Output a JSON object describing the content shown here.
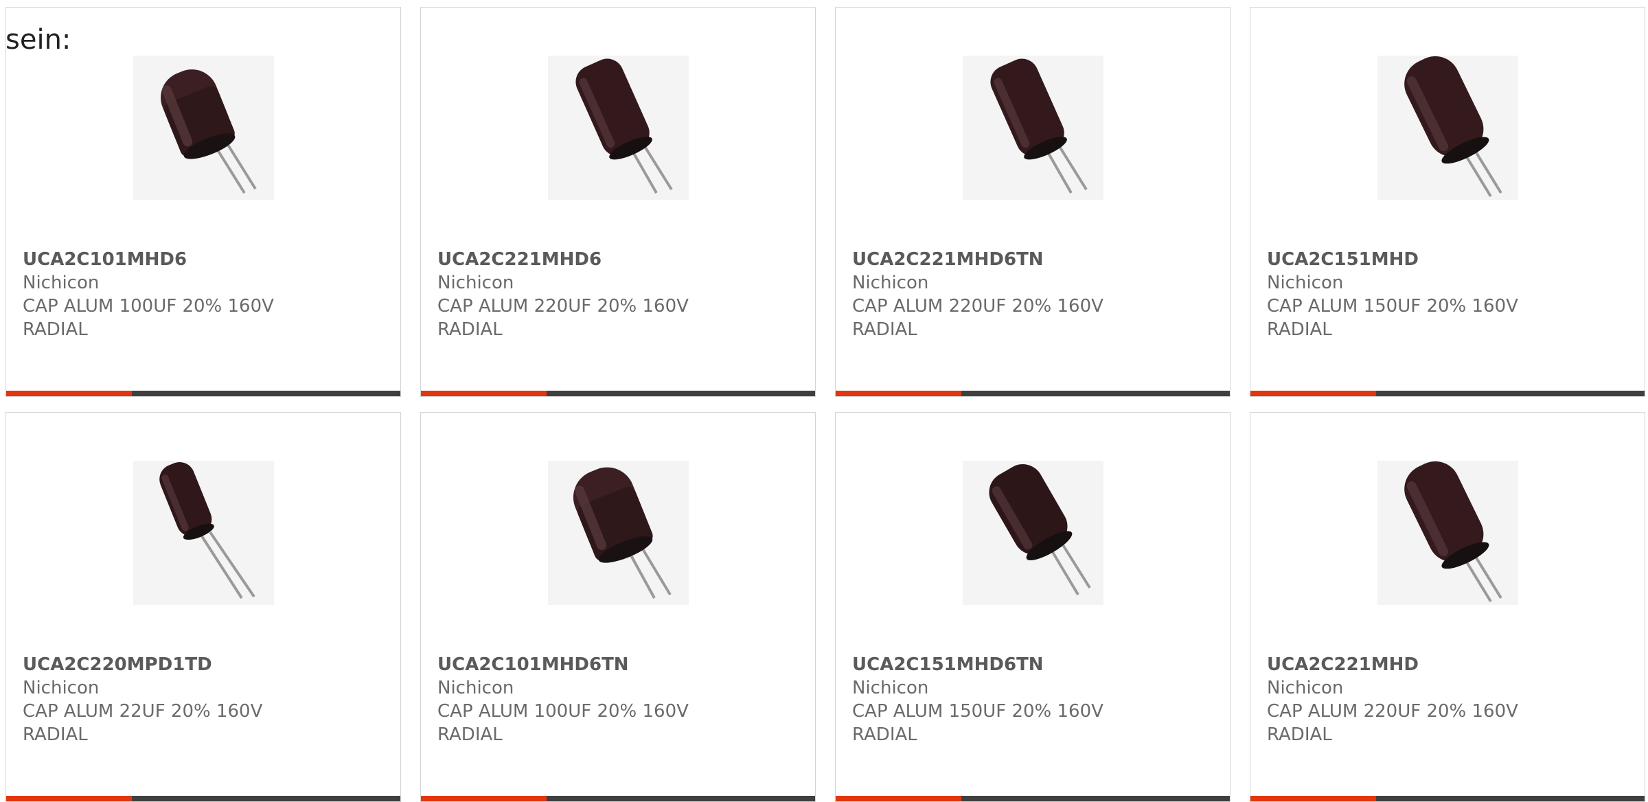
{
  "intro_text": "sein:",
  "colors": {
    "accent": "#e2360f",
    "bar_dark": "#3f3f3f",
    "card_border": "#d4d4d4",
    "text": "#6a6a6a"
  },
  "products": [
    {
      "part_number": "UCA2C101MHD6",
      "manufacturer": "Nichicon",
      "desc_line1": "CAP ALUM 100UF 20% 160V",
      "desc_line2": "RADIAL",
      "image": "capacitor-icon"
    },
    {
      "part_number": "UCA2C221MHD6",
      "manufacturer": "Nichicon",
      "desc_line1": "CAP ALUM 220UF 20% 160V",
      "desc_line2": "RADIAL",
      "image": "capacitor-icon"
    },
    {
      "part_number": "UCA2C221MHD6TN",
      "manufacturer": "Nichicon",
      "desc_line1": "CAP ALUM 220UF 20% 160V",
      "desc_line2": "RADIAL",
      "image": "capacitor-icon"
    },
    {
      "part_number": "UCA2C151MHD",
      "manufacturer": "Nichicon",
      "desc_line1": "CAP ALUM 150UF 20% 160V",
      "desc_line2": "RADIAL",
      "image": "capacitor-icon"
    },
    {
      "part_number": "UCA2C220MPD1TD",
      "manufacturer": "Nichicon",
      "desc_line1": "CAP ALUM 22UF 20% 160V",
      "desc_line2": "RADIAL",
      "image": "capacitor-icon"
    },
    {
      "part_number": "UCA2C101MHD6TN",
      "manufacturer": "Nichicon",
      "desc_line1": "CAP ALUM 100UF 20% 160V",
      "desc_line2": "RADIAL",
      "image": "capacitor-icon"
    },
    {
      "part_number": "UCA2C151MHD6TN",
      "manufacturer": "Nichicon",
      "desc_line1": "CAP ALUM 150UF 20% 160V",
      "desc_line2": "RADIAL",
      "image": "capacitor-icon"
    },
    {
      "part_number": "UCA2C221MHD",
      "manufacturer": "Nichicon",
      "desc_line1": "CAP ALUM 220UF 20% 160V",
      "desc_line2": "RADIAL",
      "image": "capacitor-icon"
    }
  ]
}
